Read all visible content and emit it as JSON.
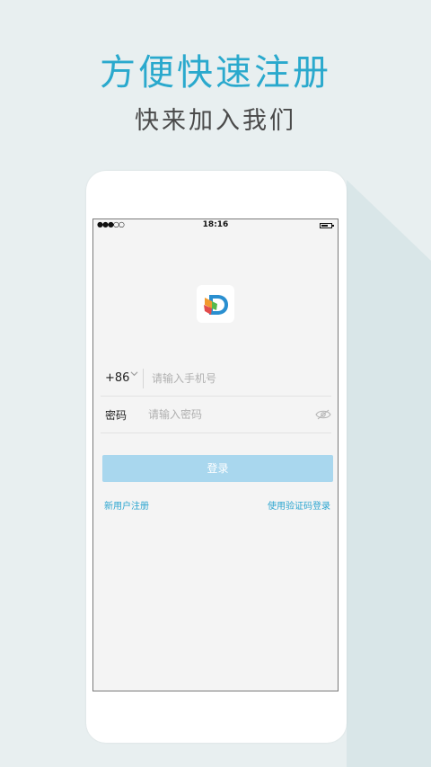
{
  "hero": {
    "title": "方便快速注册",
    "subtitle": "快来加入我们"
  },
  "statusbar": {
    "signal": "●●●○○",
    "time": "18:16"
  },
  "login": {
    "country_code": "+86",
    "phone_placeholder": "请输入手机号",
    "password_label": "密码",
    "password_placeholder": "请输入密码",
    "login_button": "登录",
    "register_link": "新用户注册",
    "sms_login_link": "使用验证码登录"
  },
  "colors": {
    "accent": "#2aa9cd",
    "button_disabled": "#a9d7ee",
    "background": "#e8eff0"
  },
  "icons": {
    "logo": "app-logo-d",
    "dropdown": "chevron-down-icon",
    "password_visibility": "eye-icon"
  }
}
